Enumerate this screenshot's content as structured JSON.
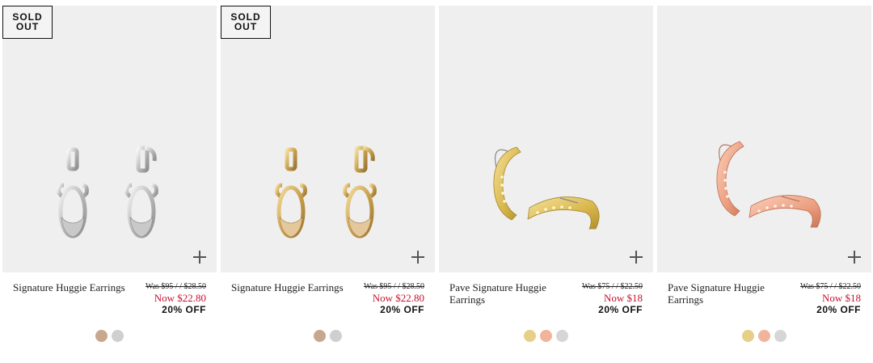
{
  "badges": {
    "sold_out_line1": "SOLD",
    "sold_out_line2": "OUT"
  },
  "products": [
    {
      "name": "Signature Huggie Earrings",
      "was": "Was $95 / / $28.50",
      "now": "Now $22.80",
      "discount": "20% OFF",
      "sold_out": true,
      "metal": "silver",
      "swatches": [
        "rose-gold",
        "silver"
      ]
    },
    {
      "name": "Signature Huggie Earrings",
      "was": "Was $95 / / $28.50",
      "now": "Now $22.80",
      "discount": "20% OFF",
      "sold_out": true,
      "metal": "gold",
      "swatches": [
        "rose-gold",
        "silver"
      ]
    },
    {
      "name": "Pave Signature Huggie Earrings",
      "was": "Was $75 / / $22.50",
      "now": "Now $18",
      "discount": "20% OFF",
      "sold_out": false,
      "metal": "gold",
      "swatches": [
        "gold",
        "rose-gold",
        "silver"
      ]
    },
    {
      "name": "Pave Signature Huggie Earrings",
      "was": "Was $75 / / $22.50",
      "now": "Now $18",
      "discount": "20% OFF",
      "sold_out": false,
      "metal": "rose-gold",
      "swatches": [
        "gold",
        "rose-gold",
        "silver"
      ]
    }
  ],
  "colors": {
    "price_now": "#c8102e",
    "image_background": "#efefef",
    "swatch_gold": "#e6cf86",
    "swatch_rose_gold": "#f0b49a",
    "swatch_silver": "#d6d6d6",
    "swatch_rose_gold_textured": "#c7a88f",
    "swatch_silver_textured": "#cfcfcf"
  },
  "icons": {
    "quick_add": "plus-icon",
    "badge": "sold-out-badge"
  }
}
